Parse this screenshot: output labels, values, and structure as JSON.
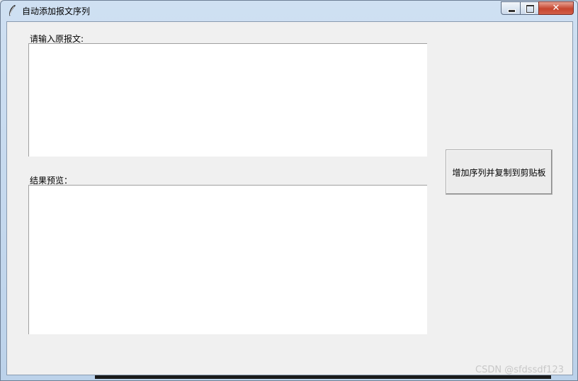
{
  "window": {
    "title": "自动添加报文序列",
    "app_icon": "feather-icon",
    "controls": {
      "minimize": "minimize-icon",
      "maximize": "maximize-icon",
      "close": "close-icon"
    },
    "close_glyph": "✕"
  },
  "form": {
    "input_label": "请输入原报文:",
    "input_value": "",
    "result_label": "结果预览：",
    "result_value": "",
    "action_button": "增加序列并复制到剪贴板"
  },
  "watermark": "CSDN @sfdssdf123",
  "colors": {
    "client_bg": "#f0f0f0",
    "close_button": "#c6462f",
    "textbox_bg": "#ffffff"
  }
}
